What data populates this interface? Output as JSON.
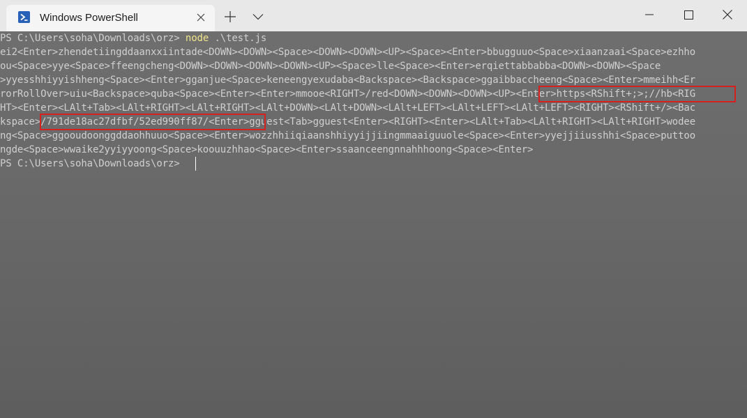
{
  "window": {
    "tab_title": "Windows PowerShell",
    "tab_icon": "powershell-icon",
    "new_tab_icon": "plus-icon",
    "dropdown_icon": "chevron-down-icon",
    "minimize_icon": "minimize-icon",
    "maximize_icon": "maximize-icon",
    "close_icon": "close-icon",
    "accent_color": "#2761b8"
  },
  "terminal": {
    "prompt_1": "PS C:\\Users\\soha\\Downloads\\orz> ",
    "command_1": "node",
    "command_1_args": " .\\test.js",
    "output_lines": [
      "ei2<Enter>zhendetiingddaanxxiintade<DOWN><DOWN><Space><DOWN><DOWN><UP><Space><Enter>bbugguuo<Space>xiaanzaai<Space>ezhho",
      "ou<Space>yye<Space>ffeengcheng<DOWN><DOWN><DOWN><DOWN><UP><Space>lle<Space><Enter>erqiettabbabba<DOWN><DOWN><Space",
      ">yyesshhiyyishheng<Space><Enter>gganjue<Space>keneengyexudaba<Backspace><Backspace>ggaibbaccheeng<Space><Enter>mmeihh<Er",
      "rorRollOver>uiu<Backspace>quba<Space><Enter><Enter>mmooe<RIGHT>/red<DOWN><DOWN><DOWN><UP><Enter>https<RShift+;>;//hb<RIG",
      "HT><Enter><LAlt+Tab><LAlt+RIGHT><LAlt+RIGHT><LAlt+DOWN><LAlt+DOWN><LAlt+LEFT><LAlt+LEFT><LAlt+LEFT><RIGHT><RShift+/><Bac",
      "kspace>/791de18ac27dfbf/52ed990ff87/<Enter>gguest<Tab>gguest<Enter><RIGHT><Enter><LAlt+Tab><LAlt+RIGHT><LAlt+RIGHT>wodee",
      "ng<Space>ggooudoonggddaohhuuo<Space><Enter>wozzhhiiqiaanshhiyyijjiingmmaaiguuole<Space><Enter>yyejjiiusshhi<Space>puttoo",
      "ngde<Space>wwaike2yyiyyoong<Space>koouuzhhao<Space><Enter>ssaanceengnnahhhoong<Space><Enter>"
    ],
    "prompt_2": "PS C:\\Users\\soha\\Downloads\\orz> "
  }
}
